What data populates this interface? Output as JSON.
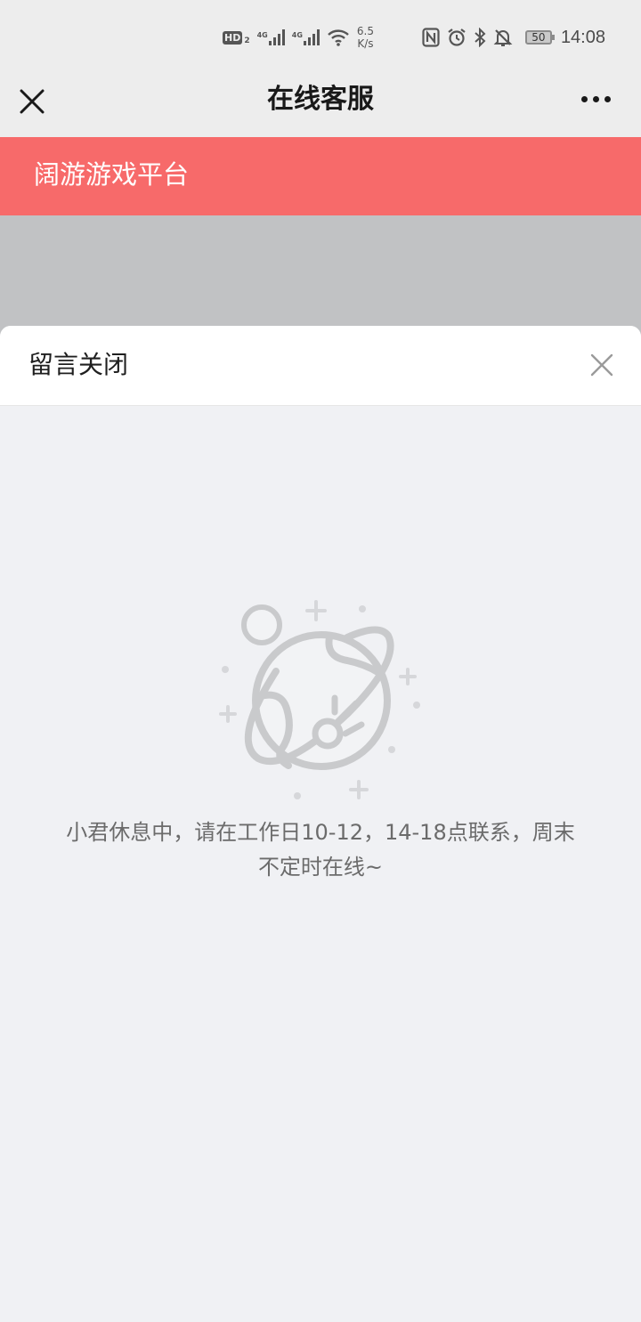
{
  "status_bar": {
    "hd_label": "HD",
    "hd_sub": "2",
    "signal1_gen": "4G",
    "signal2_gen": "4G",
    "net_speed_value": "6.5",
    "net_speed_unit": "K/s",
    "battery": "50",
    "time": "14:08",
    "icons": [
      "nfc-icon",
      "alarm-icon",
      "bluetooth-icon",
      "mute-icon"
    ]
  },
  "nav": {
    "title": "在线客服"
  },
  "brand": {
    "title": "阔游游戏平台",
    "color": "#f76a6a"
  },
  "sheet": {
    "title": "留言关闭",
    "empty_illustration": "planet-icon",
    "message_line1": "小君休息中，请在工作日10-12，14-18点联系，周末",
    "message_line2": "不定时在线~"
  }
}
